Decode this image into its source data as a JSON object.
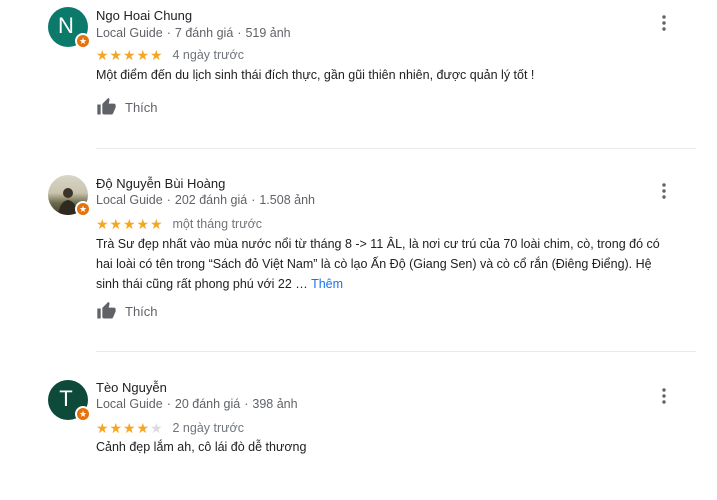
{
  "reviews": [
    {
      "name": "Ngo Hoai Chung",
      "avatar_letter": "N",
      "avatar_color": "#0b7a6b",
      "local_guide": "Local Guide",
      "reviews_count": "7 đánh giá",
      "photos_count": "519 ảnh",
      "rating": 5,
      "date": "4 ngày trước",
      "text": "Một điểm đến du lịch sinh thái đích thực, gần gũi thiên nhiên,  được quản lý tốt !",
      "more": "",
      "like_label": "Thích"
    },
    {
      "name": "Độ Nguyễn Bùi Hoàng",
      "avatar_letter": "",
      "avatar_color": "#8a8060",
      "local_guide": "Local Guide",
      "reviews_count": "202 đánh giá",
      "photos_count": "1.508 ảnh",
      "rating": 5,
      "date": "một tháng trước",
      "text_lines": [
        "Trà Sư đẹp nhất vào mùa nước nổi từ tháng 8 -> 11 ÂL,  là nơi cư trú của 70 loài chim, cò, trong đó có",
        "hai loài có tên trong “Sách đỏ Việt Nam” là cò lạo Ấn Độ (Giang Sen) và cò cổ rắn (Điêng Điểng). Hệ",
        "sinh thái cũng rất phong phú với 22 …"
      ],
      "more": "Thêm",
      "like_label": "Thích"
    },
    {
      "name": "Tèo Nguyễn",
      "avatar_letter": "T",
      "avatar_color": "#0d4a3a",
      "local_guide": "Local Guide",
      "reviews_count": "20 đánh giá",
      "photos_count": "398 ảnh",
      "rating": 4,
      "date": "2 ngày trước",
      "text": "Cảnh đẹp lắm ah, cô lái đò dễ thương",
      "more": "",
      "like_label": ""
    }
  ],
  "colors": {
    "star": "#f5a623",
    "star_empty": "#dadce0",
    "badge": "#e8710a",
    "link": "#1a73e8"
  },
  "icons": {
    "like": "thumb-up-icon",
    "menu": "more-vert-icon",
    "badge": "local-guide-badge-icon"
  }
}
